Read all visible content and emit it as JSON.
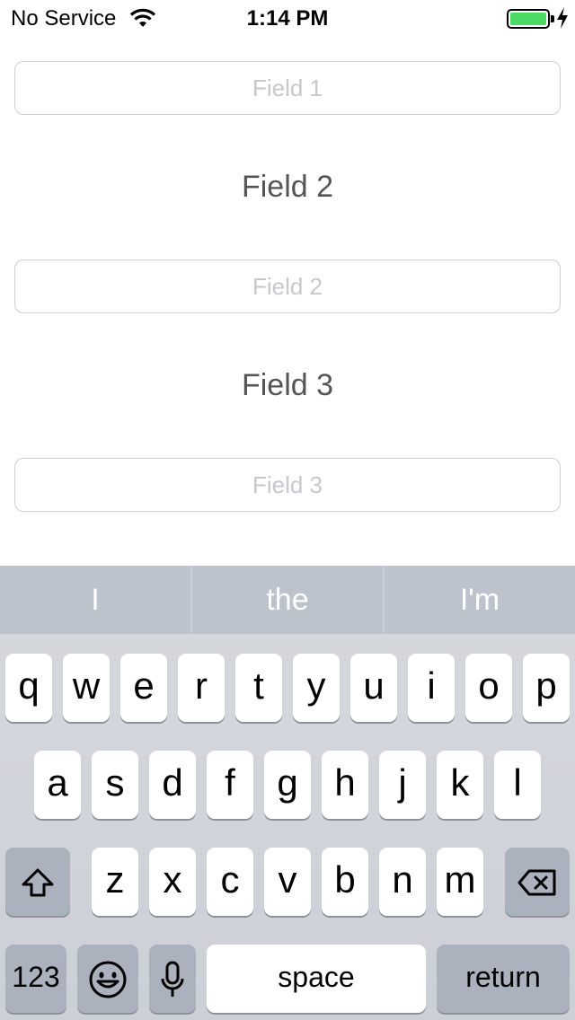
{
  "status_bar": {
    "carrier": "No Service",
    "time": "1:14 PM",
    "wifi_icon": "wifi-icon",
    "battery_icon": "battery-icon",
    "battery_color": "#4cd964",
    "battery_level": 1.0,
    "charging_icon": "bolt-icon"
  },
  "form": {
    "field1": {
      "placeholder": "Field 1",
      "value": ""
    },
    "label2": "Field 2",
    "field2": {
      "placeholder": "Field 2",
      "value": ""
    },
    "label3": "Field 3",
    "field3": {
      "placeholder": "Field 3",
      "value": ""
    }
  },
  "keyboard": {
    "suggestions": [
      "I",
      "the",
      "I'm"
    ],
    "row1": [
      "q",
      "w",
      "e",
      "r",
      "t",
      "y",
      "u",
      "i",
      "o",
      "p"
    ],
    "row2": [
      "a",
      "s",
      "d",
      "f",
      "g",
      "h",
      "j",
      "k",
      "l"
    ],
    "row3": [
      "z",
      "x",
      "c",
      "v",
      "b",
      "n",
      "m"
    ],
    "shift_icon": "shift-icon",
    "delete_icon": "delete-icon",
    "numbers_label": "123",
    "emoji_icon": "emoji-icon",
    "mic_icon": "microphone-icon",
    "space_label": "space",
    "return_label": "return"
  }
}
